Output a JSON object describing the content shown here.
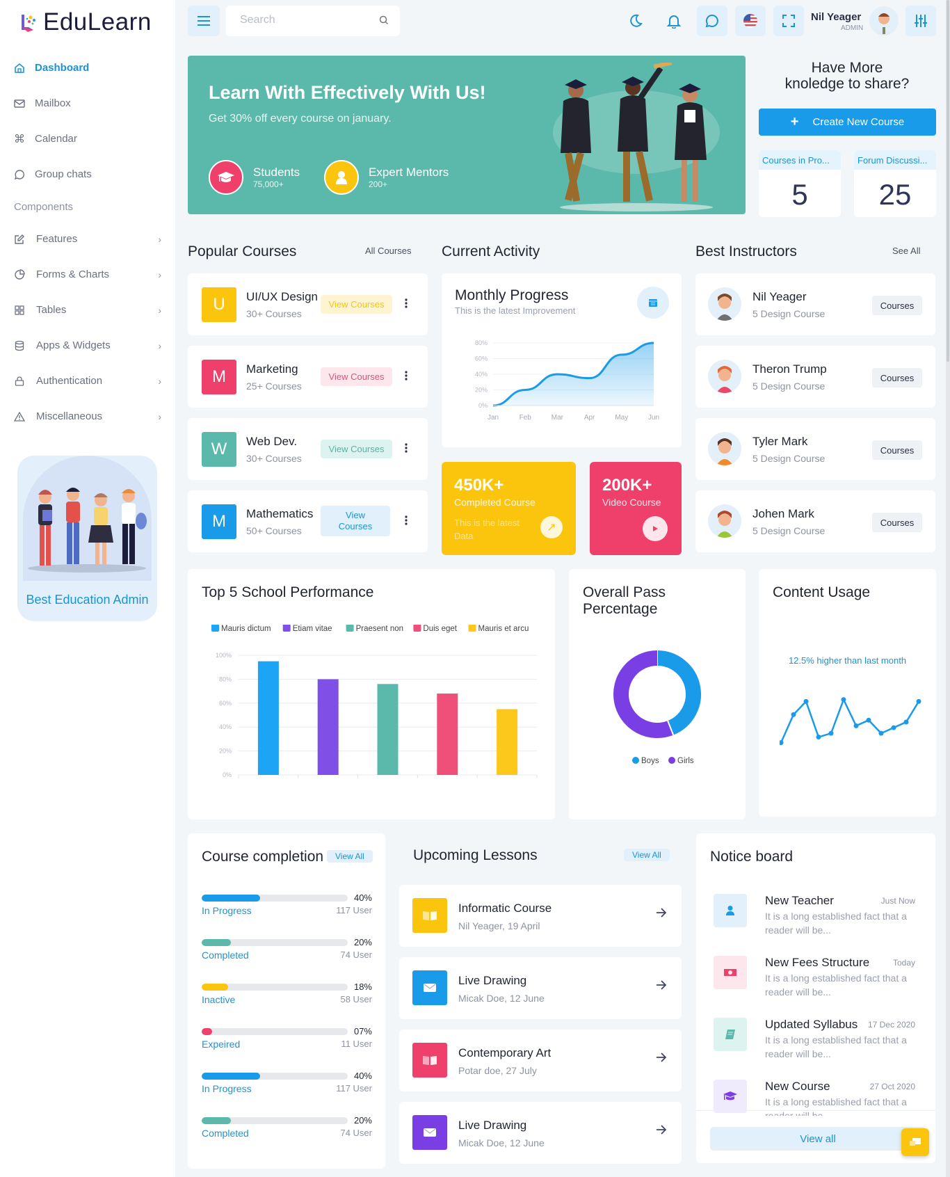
{
  "brand": {
    "name": "EduLearn"
  },
  "sidebar": {
    "items": [
      {
        "label": "Dashboard",
        "icon": "home-icon",
        "active": true
      },
      {
        "label": "Mailbox",
        "icon": "mail-icon"
      },
      {
        "label": "Calendar",
        "icon": "command-icon"
      },
      {
        "label": "Group chats",
        "icon": "chat-icon"
      }
    ],
    "section_label": "Components",
    "sub_items": [
      {
        "label": "Features",
        "icon": "edit-icon"
      },
      {
        "label": "Forms & Charts",
        "icon": "pie-chart-icon"
      },
      {
        "label": "Tables",
        "icon": "grid-icon"
      },
      {
        "label": "Apps & Widgets",
        "icon": "database-icon"
      },
      {
        "label": "Authentication",
        "icon": "lock-icon"
      },
      {
        "label": "Miscellaneous",
        "icon": "warning-icon"
      }
    ],
    "promo_text": "Best Education Admin"
  },
  "topbar": {
    "search_placeholder": "Search",
    "user_name": "Nil Yeager",
    "user_role": "ADMIN"
  },
  "hero": {
    "title": "Learn With Effectively With Us!",
    "subtitle": "Get 30% off every course on january.",
    "stats": [
      {
        "label": "Students",
        "value": "75,000+"
      },
      {
        "label": "Expert Mentors",
        "value": "200+"
      }
    ]
  },
  "share": {
    "title_line1": "Have More",
    "title_line2": "knoledge to share?",
    "button": "Create New Course",
    "mini": [
      {
        "label": "Courses in Pro...",
        "value": "5"
      },
      {
        "label": "Forum Discussi...",
        "value": "25"
      }
    ]
  },
  "popular": {
    "title": "Popular Courses",
    "link": "All Courses",
    "items": [
      {
        "letter": "U",
        "name": "UI/UX Design",
        "count": "30+ Courses",
        "button": "View Courses",
        "color": "#fcc50d",
        "btn_bg": "#fff4d0",
        "btn_fg": "#f5c31a"
      },
      {
        "letter": "M",
        "name": "Marketing",
        "count": "25+ Courses",
        "button": "View Courses",
        "color": "#ef3f6b",
        "btn_bg": "#fde6ec",
        "btn_fg": "#d8557a"
      },
      {
        "letter": "W",
        "name": "Web Dev.",
        "count": "30+ Courses",
        "button": "View Courses",
        "color": "#5ab9ab",
        "btn_bg": "#dcf3ef",
        "btn_fg": "#58b2a4"
      },
      {
        "letter": "M",
        "name": "Mathematics",
        "count": "50+ Courses",
        "button": "View Courses",
        "color": "#1a9be9",
        "btn_bg": "#e1f0fb",
        "btn_fg": "#1b94d4"
      }
    ]
  },
  "activity": {
    "title": "Current Activity",
    "monthly": {
      "title": "Monthly Progress",
      "subtitle": "This is the latest Improvement"
    },
    "stats": [
      {
        "value": "450K+",
        "label": "Completed Course",
        "note": "This is the latest Data",
        "color": "#fcc50d"
      },
      {
        "value": "200K+",
        "label": "Video Course",
        "color": "#ef3f6b"
      }
    ]
  },
  "instructors": {
    "title": "Best Instructors",
    "link": "See All",
    "items": [
      {
        "name": "Nil Yeager",
        "courses": "5 Design Course",
        "button": "Courses"
      },
      {
        "name": "Theron Trump",
        "courses": "5 Design Course",
        "button": "Courses"
      },
      {
        "name": "Tyler Mark",
        "courses": "5 Design Course",
        "button": "Courses"
      },
      {
        "name": "Johen Mark",
        "courses": "5 Design Course",
        "button": "Courses"
      }
    ]
  },
  "school": {
    "title": "Top 5 School Performance"
  },
  "pass": {
    "title_line1": "Overall Pass",
    "title_line2": "Percentage"
  },
  "usage": {
    "title": "Content Usage",
    "note": "12.5% higher than last month"
  },
  "completion": {
    "title": "Course completion",
    "link": "View All",
    "rows": [
      {
        "label": "In Progress",
        "pct": "40%",
        "value": 0.4,
        "users": "117 User",
        "color": "#1a9be9"
      },
      {
        "label": "Completed",
        "pct": "20%",
        "value": 0.2,
        "users": "74 User",
        "color": "#5ab9ab"
      },
      {
        "label": "Inactive",
        "pct": "18%",
        "value": 0.18,
        "users": "58 User",
        "color": "#fcc50d"
      },
      {
        "label": "Expeired",
        "pct": "07%",
        "value": 0.07,
        "users": "11 User",
        "color": "#ef3f6b"
      },
      {
        "label": "In Progress",
        "pct": "40%",
        "value": 0.4,
        "users": "117 User",
        "color": "#1a9be9"
      },
      {
        "label": "Completed",
        "pct": "20%",
        "value": 0.2,
        "users": "74 User",
        "color": "#5ab9ab"
      }
    ]
  },
  "lessons": {
    "title": "Upcoming Lessons",
    "link": "View All",
    "items": [
      {
        "name": "Informatic Course",
        "detail": "Nil Yeager, 19 April",
        "icon": "book-icon",
        "color": "#fcc50d"
      },
      {
        "name": "Live Drawing",
        "detail": "Micak Doe, 12 June",
        "icon": "mail-icon",
        "color": "#1a9be9"
      },
      {
        "name": "Contemporary Art",
        "detail": "Potar doe, 27 July",
        "icon": "book-icon",
        "color": "#ef3f6b"
      },
      {
        "name": "Live Drawing",
        "detail": "Micak Doe, 12 June",
        "icon": "mail-icon",
        "color": "#7a3fe4"
      }
    ]
  },
  "notices": {
    "title": "Notice board",
    "view_all": "View all",
    "items": [
      {
        "title": "New Teacher",
        "time": "Just Now",
        "desc": "It is a long established fact that a reader will be...",
        "icon": "user-icon",
        "bg": "#e1f0fb",
        "fg": "#1a9be9"
      },
      {
        "title": "New Fees Structure",
        "time": "Today",
        "desc": "It is a long established fact that a reader will be...",
        "icon": "money-icon",
        "bg": "#fde6ec",
        "fg": "#ef3f6b"
      },
      {
        "title": "Updated Syllabus",
        "time": "17 Dec 2020",
        "desc": "It is a long established fact that a reader will be...",
        "icon": "book-icon",
        "bg": "#dcf3ef",
        "fg": "#5ab9ab"
      },
      {
        "title": "New Course",
        "time": "27 Oct 2020",
        "desc": "It is a long established fact that a reader will be...",
        "icon": "graduation-cap-icon",
        "bg": "#efeafc",
        "fg": "#7a3fe4"
      }
    ]
  },
  "chart_data": [
    {
      "type": "area",
      "title": "Monthly Progress",
      "categories": [
        "Jan",
        "Feb",
        "Mar",
        "Apr",
        "May",
        "Jun"
      ],
      "yticks": [
        "0%",
        "20%",
        "40%",
        "60%",
        "80%"
      ],
      "ylim": [
        0,
        80
      ],
      "values": [
        0,
        20,
        40,
        35,
        65,
        80
      ],
      "color": "#1a9be9"
    },
    {
      "type": "bar",
      "title": "Top 5 School Performance",
      "categories": [
        "Mauris dictum",
        "Etiam vitae",
        "Praesent non",
        "Duis eget",
        "Mauris et arcu"
      ],
      "values": [
        95,
        80,
        76,
        68,
        55
      ],
      "colors": [
        "#1ea4f5",
        "#7f4fe6",
        "#5ab9ab",
        "#ef5079",
        "#fcc81b"
      ],
      "yticks": [
        "0%",
        "20%",
        "40%",
        "60%",
        "80%",
        "100%"
      ],
      "ylim": [
        0,
        100
      ],
      "legend": "top"
    },
    {
      "type": "pie",
      "title": "Overall Pass Percentage",
      "labels": [
        "Boys",
        "Girls"
      ],
      "values": [
        44,
        56
      ],
      "colors": [
        "#1a9be9",
        "#7a3fe4"
      ],
      "legend": "bottom"
    },
    {
      "type": "line",
      "title": "Content Usage",
      "values": [
        10,
        25,
        32,
        13,
        15,
        33,
        19,
        22,
        15,
        18,
        21,
        32
      ],
      "color": "#1a9be9"
    }
  ]
}
